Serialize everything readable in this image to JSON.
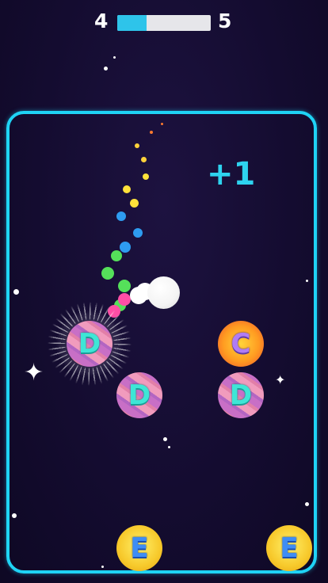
{
  "hud": {
    "current_level": "4",
    "next_level": "5",
    "progress": 0.31
  },
  "score_popup": "+1",
  "letter_balls": [
    {
      "letter": "D",
      "style": "pink",
      "highlighted": true
    },
    {
      "letter": "C",
      "style": "orange",
      "highlighted": false
    },
    {
      "letter": "D",
      "style": "pink",
      "highlighted": false
    },
    {
      "letter": "D",
      "style": "pink",
      "highlighted": false
    },
    {
      "letter": "E",
      "style": "yellow",
      "highlighted": false
    },
    {
      "letter": "E",
      "style": "yellow",
      "highlighted": false
    }
  ],
  "colors": {
    "arena_border": "#1fd3f5",
    "progress_fill": "#2ec4ea",
    "progress_track": "#e6e6ea",
    "bonus_text": "#2ed3ef",
    "background": "#140c30"
  }
}
